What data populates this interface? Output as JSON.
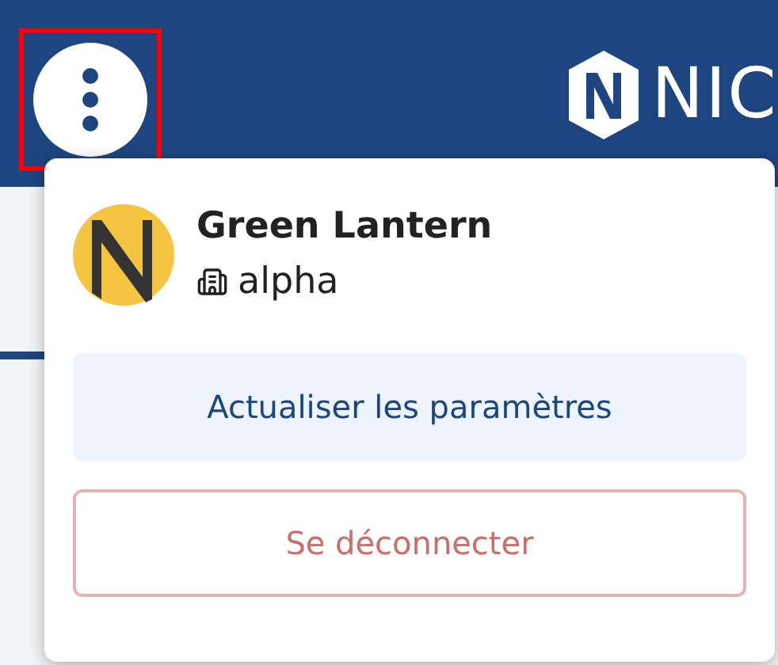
{
  "header": {
    "menu_button": {
      "highlighted": true
    },
    "logo_text": "NIC"
  },
  "user_menu": {
    "name": "Green Lantern",
    "organization": "alpha",
    "actions": [
      {
        "label": "Actualiser les paramètres",
        "kind": "primary"
      },
      {
        "label": "Se déconnecter",
        "kind": "danger"
      }
    ]
  }
}
